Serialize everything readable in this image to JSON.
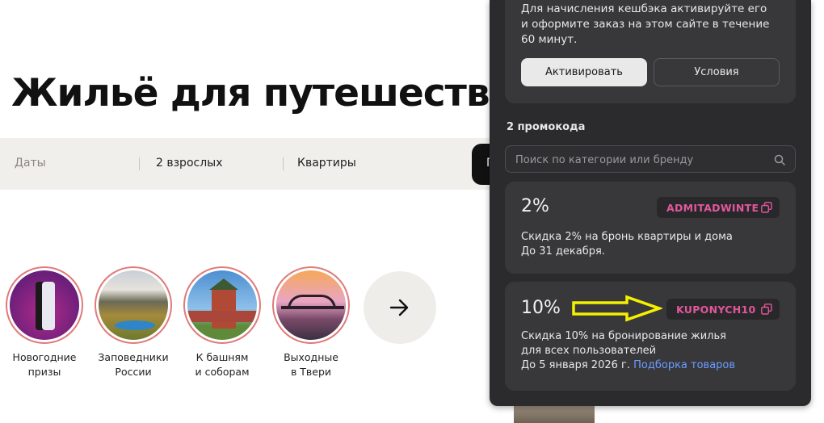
{
  "page": {
    "title": "Жильё для путешествия",
    "search": {
      "dates": "Даты",
      "guests": "2 взрослых",
      "type": "Квартиры"
    },
    "stories": [
      {
        "caption_line1": "Новогодние",
        "caption_line2": "призы"
      },
      {
        "caption_line1": "Заповедники",
        "caption_line2": "России"
      },
      {
        "caption_line1": "К башням",
        "caption_line2": "и соборам"
      },
      {
        "caption_line1": "Выходные",
        "caption_line2": "в Твери"
      }
    ]
  },
  "panel": {
    "cashback_text": "Для начисления кешбэка активируйте его и оформите заказ на этом сайте в течение 60 минут.",
    "activate_label": "Активировать",
    "terms_label": "Условия",
    "promo_count": "2 промокода",
    "search_placeholder": "Поиск по категории или бренду",
    "promos": [
      {
        "percent": "2%",
        "code": "ADMITADWINTE",
        "line1": "Скидка 2% на бронь квартиры и дома",
        "line2": "До 31 декабря."
      },
      {
        "percent": "10%",
        "code": "KUPONYCH10",
        "line1": "Скидка 10% на бронирование жилья",
        "line2": "для всех пользователей",
        "line3": "До 5 января 2026 г.",
        "link": "Подборка товаров"
      }
    ]
  },
  "colors": {
    "panel_bg": "#2b2b2e",
    "card_bg": "#38383b",
    "promo_code": "#e2579a",
    "link": "#6b9dff",
    "annotation_arrow": "#f5f000"
  }
}
